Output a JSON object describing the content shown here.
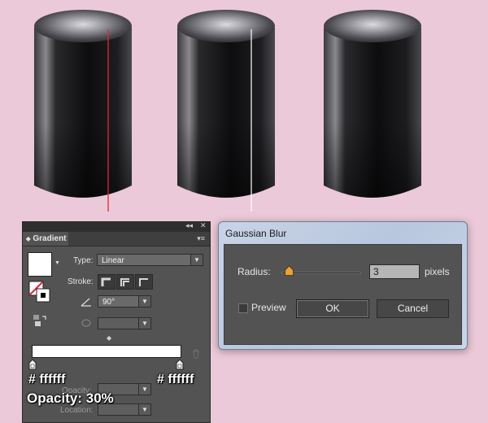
{
  "gradient_panel": {
    "tab_title": "Gradient",
    "collapse_glyph": "◂◂",
    "close_glyph": "✕",
    "menu_glyph": "▾≡",
    "type_label": "Type:",
    "type_value": "Linear",
    "stroke_label": "Stroke:",
    "angle_value": "90°",
    "opacity_label": "Opacity:",
    "location_label": "Location:"
  },
  "annotations": {
    "left_stop_color": "# ffffff",
    "right_stop_color": "# ffffff",
    "opacity_text": "Opacity: 30%"
  },
  "gaussian_blur": {
    "title": "Gaussian Blur",
    "radius_label": "Radius:",
    "radius_value": "3",
    "unit_label": "pixels",
    "preview_label": "Preview",
    "preview_checked": false,
    "ok_label": "OK",
    "cancel_label": "Cancel"
  },
  "colors": {
    "background": "#ecc9d8",
    "red_line": "#e0283a",
    "white_line": "#ffffff",
    "panel_bg": "#535353"
  }
}
